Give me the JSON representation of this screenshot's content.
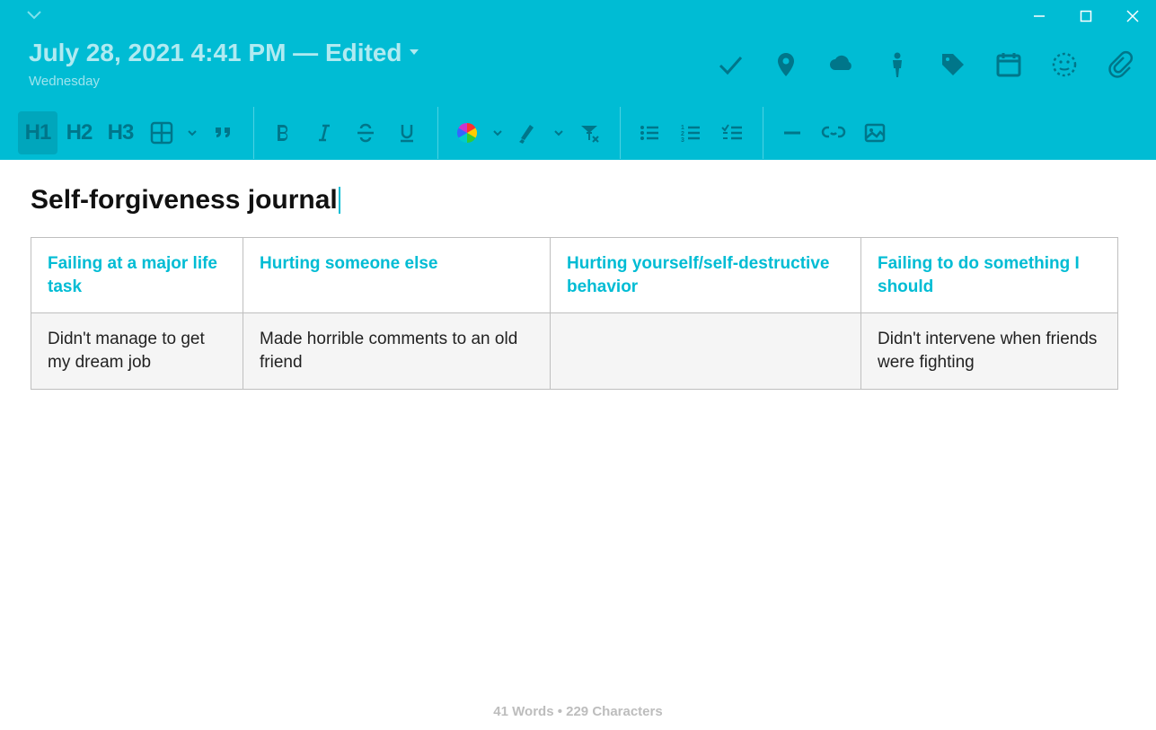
{
  "header": {
    "date_line": "July 28, 2021 4:41 PM — Edited",
    "day_of_week": "Wednesday"
  },
  "toolbar": {
    "h1": "H1",
    "h2": "H2",
    "h3": "H3"
  },
  "document": {
    "title": "Self-forgiveness journal",
    "table": {
      "headers": [
        "Failing at a major life task",
        "Hurting someone else",
        "Hurting yourself/self-destructive behavior",
        "Failing to do something I should"
      ],
      "row1": [
        "Didn't manage to get my dream job",
        "Made horrible comments to an old friend",
        "",
        "Didn't intervene when friends were fighting"
      ]
    }
  },
  "footer": {
    "stats": "41 Words • 229 Characters"
  }
}
